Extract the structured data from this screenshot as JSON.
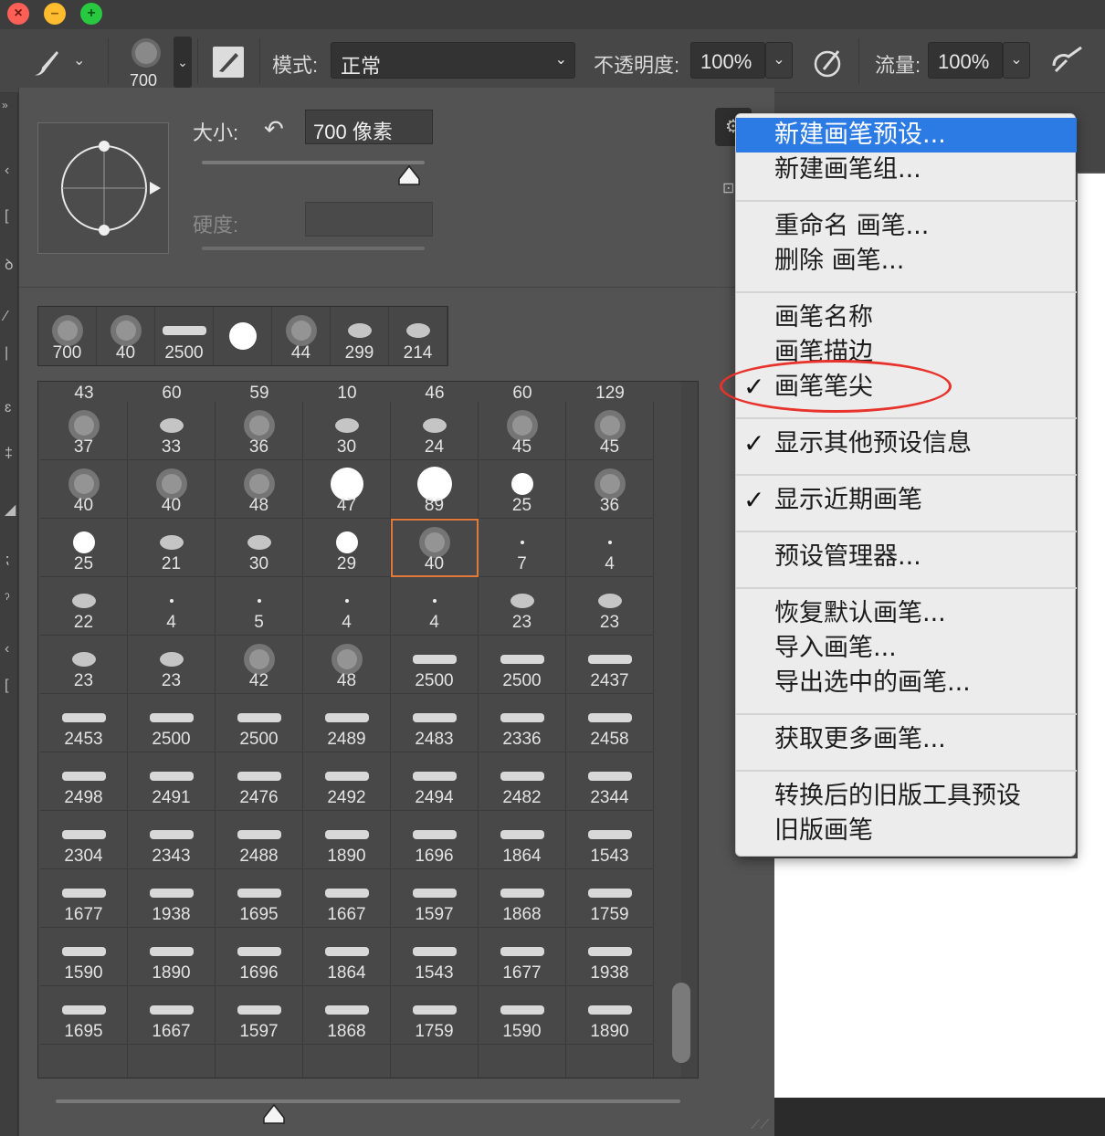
{
  "options_bar": {
    "brush_size": "700",
    "mode_label": "模式:",
    "mode_value": "正常",
    "opacity_label": "不透明度:",
    "opacity_value": "100%",
    "flow_label": "流量:",
    "flow_value": "100%"
  },
  "brush_panel": {
    "size_label": "大小:",
    "size_value": "700 像素",
    "hardness_label": "硬度:",
    "size_slider": 0.93,
    "recent": [
      "700",
      "40",
      "2500",
      "",
      "44",
      "299",
      "214"
    ],
    "top_row": [
      "43",
      "60",
      "59",
      "10",
      "46",
      "60",
      "129"
    ],
    "rows": [
      [
        "37",
        "33",
        "36",
        "30",
        "24",
        "45",
        "45"
      ],
      [
        "40",
        "40",
        "48",
        "47",
        "89",
        "25",
        "36"
      ],
      [
        "25",
        "21",
        "30",
        "29",
        "40",
        "7",
        "4"
      ],
      [
        "22",
        "4",
        "5",
        "4",
        "4",
        "23",
        "23"
      ],
      [
        "23",
        "23",
        "42",
        "48",
        "2500",
        "2500",
        "2437"
      ],
      [
        "2453",
        "2500",
        "2500",
        "2489",
        "2483",
        "2336",
        "2458"
      ],
      [
        "2498",
        "2491",
        "2476",
        "2492",
        "2494",
        "2482",
        "2344"
      ],
      [
        "2304",
        "2343",
        "2488",
        "1890",
        "1696",
        "1864",
        "1543"
      ],
      [
        "1677",
        "1938",
        "1695",
        "1667",
        "1597",
        "1868",
        "1759"
      ],
      [
        "1590",
        "1890",
        "1696",
        "1864",
        "1543",
        "1677",
        "1938"
      ],
      [
        "1695",
        "1667",
        "1597",
        "1868",
        "1759",
        "1590",
        "1890"
      ],
      [
        "",
        "",
        "",
        "",
        "",
        "",
        ""
      ]
    ],
    "selected": "40"
  },
  "menu": {
    "items": [
      {
        "label": "新建画笔预设...",
        "checked": false,
        "highlighted": true
      },
      {
        "label": "新建画笔组...",
        "checked": false
      },
      {
        "label": "重命名 画笔...",
        "checked": false
      },
      {
        "label": "删除 画笔...",
        "checked": false
      },
      {
        "label": "画笔名称",
        "checked": false
      },
      {
        "label": "画笔描边",
        "checked": false
      },
      {
        "label": "画笔笔尖",
        "checked": true
      },
      {
        "label": "显示其他预设信息",
        "checked": true
      },
      {
        "label": "显示近期画笔",
        "checked": true
      },
      {
        "label": "预设管理器...",
        "checked": false
      },
      {
        "label": "恢复默认画笔...",
        "checked": false
      },
      {
        "label": "导入画笔...",
        "checked": false
      },
      {
        "label": "导出选中的画笔...",
        "checked": false
      },
      {
        "label": "获取更多画笔...",
        "checked": false
      },
      {
        "label": "转换后的旧版工具预设",
        "checked": false
      },
      {
        "label": "旧版画笔",
        "checked": false
      }
    ],
    "check_glyph": "✓"
  },
  "colors": {
    "highlight": "#2c7be5",
    "annotation": "#e8322c",
    "selection": "#e07a3a"
  }
}
